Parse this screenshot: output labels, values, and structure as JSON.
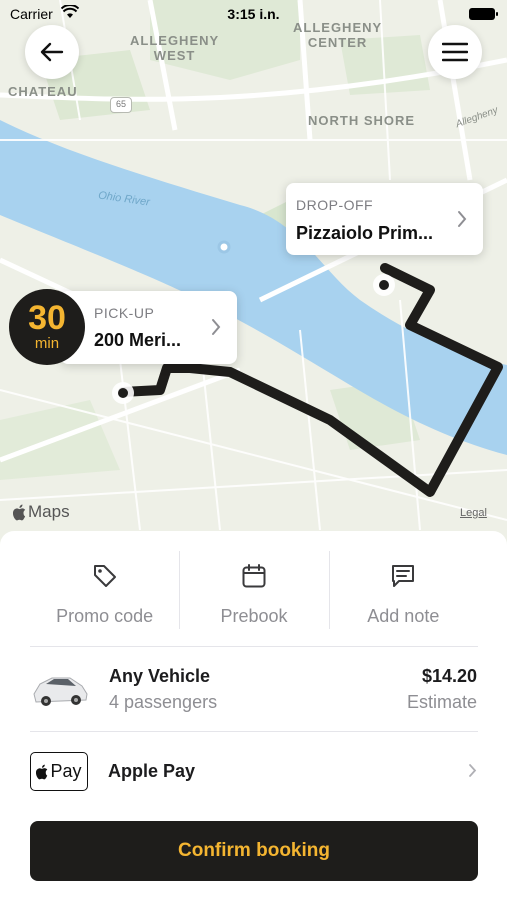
{
  "status_bar": {
    "carrier": "Carrier",
    "time": "3:15 i.n."
  },
  "map": {
    "districts": [
      "ALLEGHENY\nWEST",
      "ALLEGHENY\nCENTER",
      "CHATEAU",
      "NORTH SHORE"
    ],
    "river_label": "Ohio River",
    "road_label": "Allegheny",
    "route_shield": "65",
    "attribution": "Maps",
    "legal": "Legal",
    "route_color": "#1e1d1b",
    "water_color": "#a8d2ef"
  },
  "dropoff": {
    "caption": "DROP-OFF",
    "value": "Pizzaiolo Prim..."
  },
  "pickup": {
    "caption": "PICK-UP",
    "value": "200 Meri..."
  },
  "eta": {
    "minutes": "30",
    "unit": "min"
  },
  "actions": [
    {
      "label": "Promo code",
      "icon": "tag-icon"
    },
    {
      "label": "Prebook",
      "icon": "calendar-icon"
    },
    {
      "label": "Add note",
      "icon": "note-icon"
    }
  ],
  "vehicle": {
    "name": "Any Vehicle",
    "passengers": "4 passengers",
    "price": "$14.20",
    "price_note": "Estimate"
  },
  "payment": {
    "badge": "Pay",
    "label": "Apple Pay"
  },
  "confirm_label": "Confirm booking",
  "colors": {
    "accent": "#f4b531",
    "dark": "#1e1d1b"
  }
}
